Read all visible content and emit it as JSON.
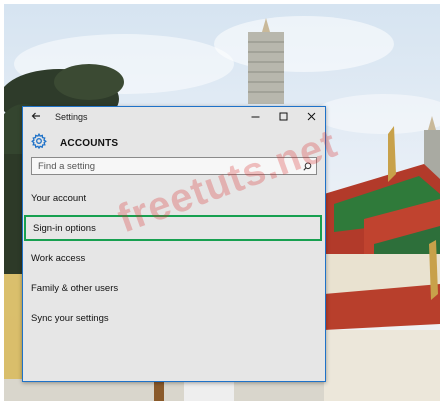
{
  "window": {
    "title": "Settings",
    "header": "ACCOUNTS",
    "controls": [
      "minimize",
      "maximize",
      "close"
    ]
  },
  "search": {
    "placeholder": "Find a setting"
  },
  "nav": {
    "items": [
      {
        "label": "Your account",
        "selected": false
      },
      {
        "label": "Sign-in options",
        "selected": true
      },
      {
        "label": "Work access",
        "selected": false
      },
      {
        "label": "Family & other users",
        "selected": false
      },
      {
        "label": "Sync your settings",
        "selected": false
      }
    ]
  },
  "watermark": "freetuts.net",
  "icons": {
    "back": "back-arrow-icon",
    "header": "gear-icon",
    "search": "search-icon"
  },
  "colors": {
    "accent": "#1f72c8",
    "selection_border": "#17a050",
    "window_bg": "#e6e6e6",
    "watermark": "#d62828"
  }
}
